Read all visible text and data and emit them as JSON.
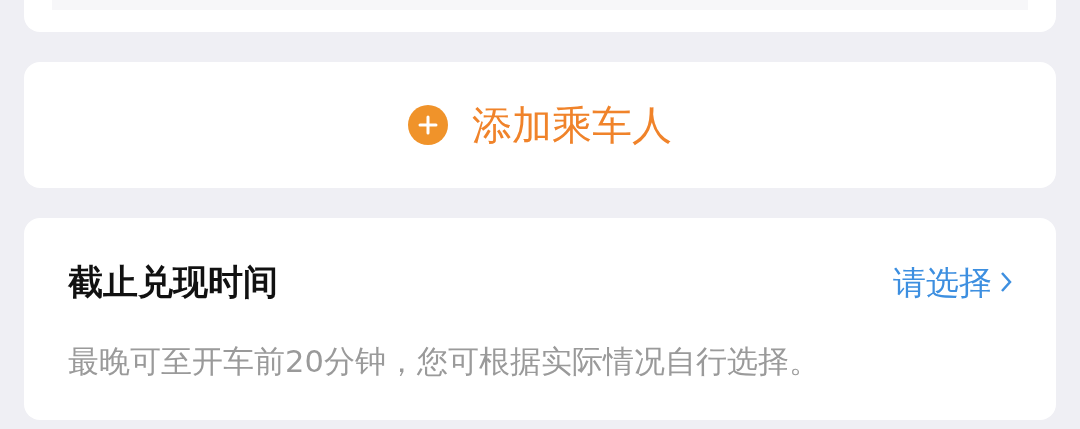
{
  "add_passenger": {
    "label": "添加乘车人"
  },
  "deadline": {
    "title": "截止兑现时间",
    "action": "请选择",
    "hint": "最晚可至开车前20分钟，您可根据实际情况自行选择。"
  }
}
